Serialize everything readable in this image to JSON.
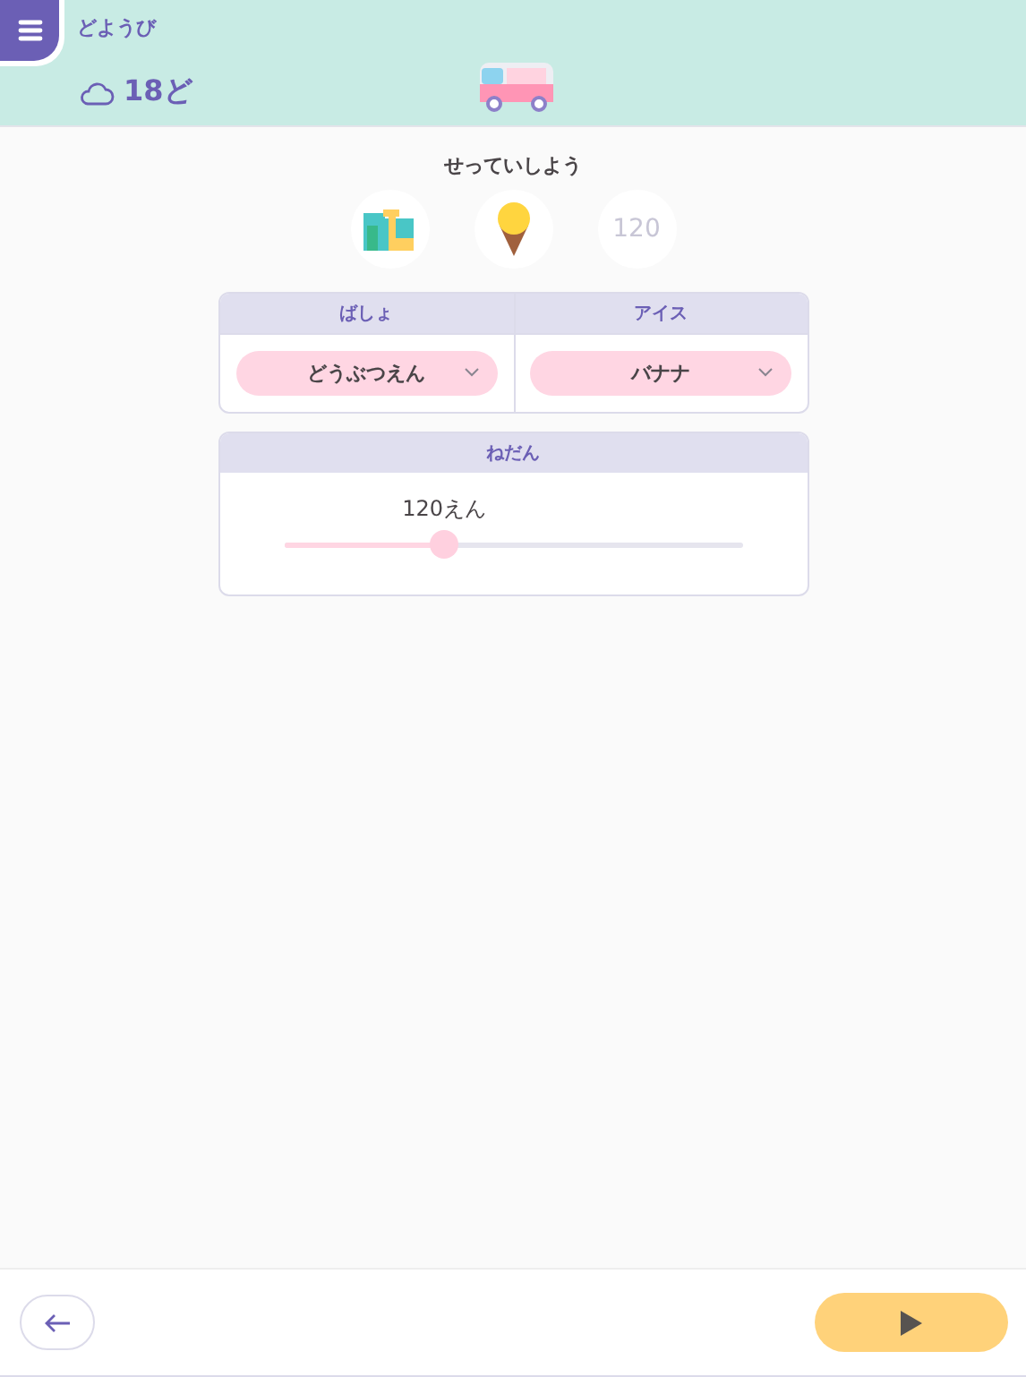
{
  "header": {
    "day": "どようび",
    "temperature": "18ど"
  },
  "setup": {
    "title": "せっていしよう",
    "summary_price": "120"
  },
  "selects": [
    {
      "label": "ばしょ",
      "value": "どうぶつえん"
    },
    {
      "label": "アイス",
      "value": "バナナ"
    }
  ],
  "price": {
    "label": "ねだん",
    "reading": "120えん",
    "level": 0.35
  }
}
